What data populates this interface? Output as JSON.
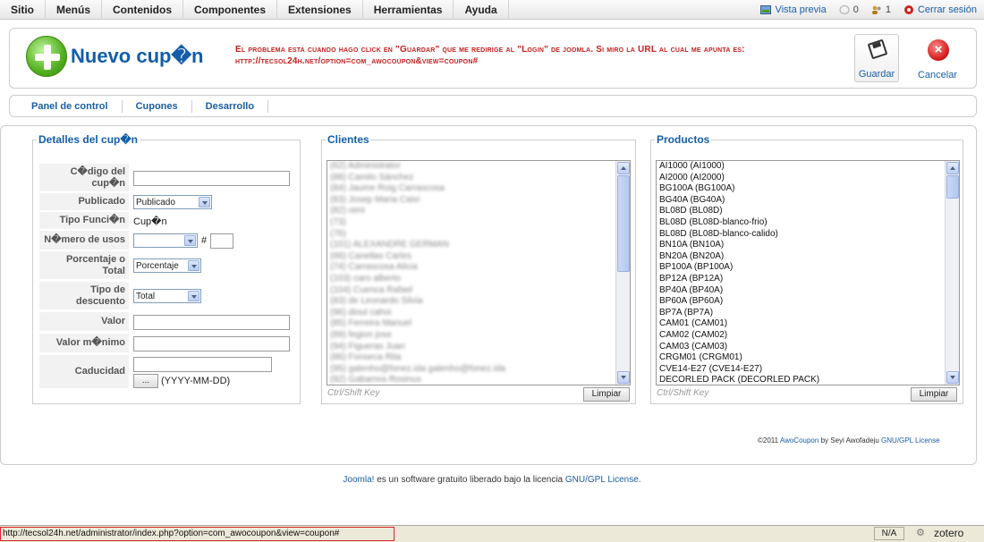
{
  "topmenu": {
    "items": [
      "Sitio",
      "Menús",
      "Contenidos",
      "Componentes",
      "Extensiones",
      "Herramientas",
      "Ayuda"
    ],
    "preview": "Vista previa",
    "messages_count": "0",
    "users_count": "1",
    "logout": "Cerrar sesión"
  },
  "toolbar": {
    "title": "Nuevo cup�n",
    "note": "El problema esta cuando hago click en \"Guardar\" que me redirige al \"Login\" de joomla. Si miro la URL al cual me apunta es: http://tecsol24h.net/option=com_awocoupon&view=coupon#",
    "save_label": "Guardar",
    "cancel_label": "Cancelar"
  },
  "subnav": [
    "Panel de control",
    "Cupones",
    "Desarrollo"
  ],
  "details": {
    "legend": "Detalles del cup�n",
    "labels": {
      "code": "C�digo del cup�n",
      "published": "Publicado",
      "function_type": "Tipo Funci�n",
      "uses": "N�mero de usos",
      "percent_total": "Porcentaje o Total",
      "discount_type": "Tipo de descuento",
      "value": "Valor",
      "min_value": "Valor m�nimo",
      "expiry": "Caducidad"
    },
    "published_value": "Publicado",
    "function_value": "Cup�n",
    "uses_value": "",
    "uses_hash": "#",
    "percent_value": "Porcentaje",
    "discount_value": "Total",
    "date_button": "...",
    "date_hint": "(YYYY-MM-DD)"
  },
  "clients": {
    "legend": "Clientes",
    "items": [
      "(62) Administrator",
      "(88) Camilo Sánchez",
      "(84) Jaume Roig Carrascosa",
      "(83) Josep Maria Caivi",
      "(82) oimi",
      "(73)",
      "(76)",
      "(101) ALEXANDRE GERMAN",
      "(66) Canellas Carles",
      "(74) Carrascosa Alicia",
      "(103) caro alberto",
      "(104) Cuenca Rafael",
      "(83) de Leonardo Silvia",
      "(96) dioul cahoi",
      "(85) Ferreira Manuel",
      "(89) fegion jose",
      "(94) Figueras Juan",
      "(86) Fonseca Rita",
      "(95) galenho@fonez.ida galenho@fonez.ida",
      "(92) Gabarrea Rosinus"
    ],
    "hint": "Ctrl/Shift Key",
    "clear": "Limpiar"
  },
  "products": {
    "legend": "Productos",
    "items": [
      "AI1000 (AI1000)",
      "AI2000 (AI2000)",
      "BG100A (BG100A)",
      "BG40A (BG40A)",
      "BL08D (BL08D)",
      "BL08D (BL08D-blanco-frio)",
      "BL08D (BL08D-blanco-calido)",
      "BN10A (BN10A)",
      "BN20A (BN20A)",
      "BP100A (BP100A)",
      "BP12A (BP12A)",
      "BP40A (BP40A)",
      "BP60A (BP60A)",
      "BP7A (BP7A)",
      "CAM01 (CAM01)",
      "CAM02 (CAM02)",
      "CAM03 (CAM03)",
      "CRGM01 (CRGM01)",
      "CVE14-E27 (CVE14-E27)",
      "DECORLED PACK (DECORLED PACK)"
    ],
    "hint": "Ctrl/Shift Key",
    "clear": "Limpiar"
  },
  "copyright": {
    "prefix": "©2011",
    "product": "AwoCoupon",
    "by": "by Seyi Awofadeju",
    "license": "GNU/GPL License"
  },
  "footer": {
    "joomla": "Joomla!",
    "text": "es un software gratuito liberado bajo la licencia",
    "license": "GNU/GPL License."
  },
  "statusbar": {
    "url": "http://tecsol24h.net/administrator/index.php?option=com_awocoupon&view=coupon#",
    "na": "N/A",
    "zotero": "zotero"
  }
}
